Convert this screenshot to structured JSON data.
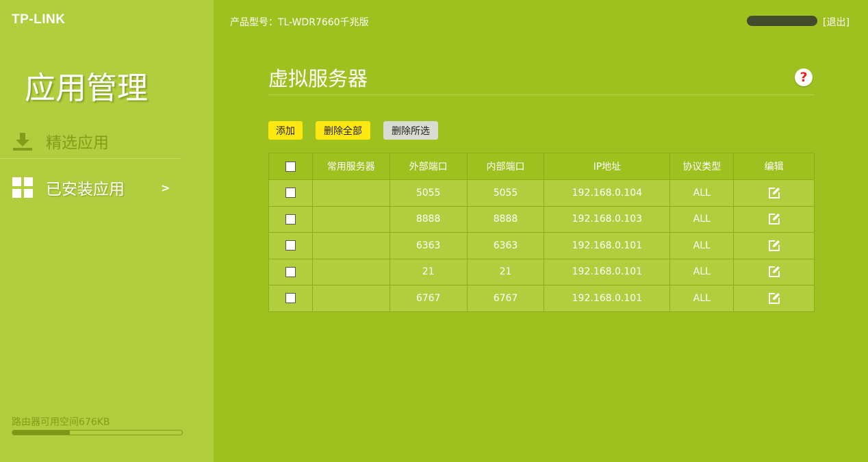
{
  "brand": {
    "logo": "TP-LINK"
  },
  "sidebar": {
    "title": "应用管理",
    "items": [
      {
        "label": "精选应用",
        "icon": "download-icon"
      },
      {
        "label": "已安装应用",
        "icon": "grid-icon",
        "arrow": ">"
      }
    ],
    "storage": {
      "label": "路由器可用空间676KB",
      "used_fraction": 0.34
    }
  },
  "header": {
    "model": "产品型号：TL-WDR7660千兆版",
    "logout": "[退出]"
  },
  "main": {
    "title": "虚拟服务器",
    "help": "?",
    "buttons": {
      "add": "添加",
      "delete_all": "删除全部",
      "delete_selected": "删除所选"
    },
    "table": {
      "headers": [
        "常用服务器",
        "外部端口",
        "内部端口",
        "IP地址",
        "协议类型",
        "编辑"
      ],
      "rows": [
        {
          "server": "",
          "ext": "5055",
          "int": "5055",
          "ip": "192.168.0.104",
          "proto": "ALL"
        },
        {
          "server": "",
          "ext": "8888",
          "int": "8888",
          "ip": "192.168.0.103",
          "proto": "ALL"
        },
        {
          "server": "",
          "ext": "6363",
          "int": "6363",
          "ip": "192.168.0.101",
          "proto": "ALL"
        },
        {
          "server": "",
          "ext": "21",
          "int": "21",
          "ip": "192.168.0.101",
          "proto": "ALL"
        },
        {
          "server": "",
          "ext": "6767",
          "int": "6767",
          "ip": "192.168.0.101",
          "proto": "ALL"
        }
      ]
    }
  },
  "colors": {
    "background": "#9fc11f",
    "sidebar": "#b2cd3e",
    "button_yellow": "#ffe812",
    "button_gray": "#d9dcd0"
  }
}
